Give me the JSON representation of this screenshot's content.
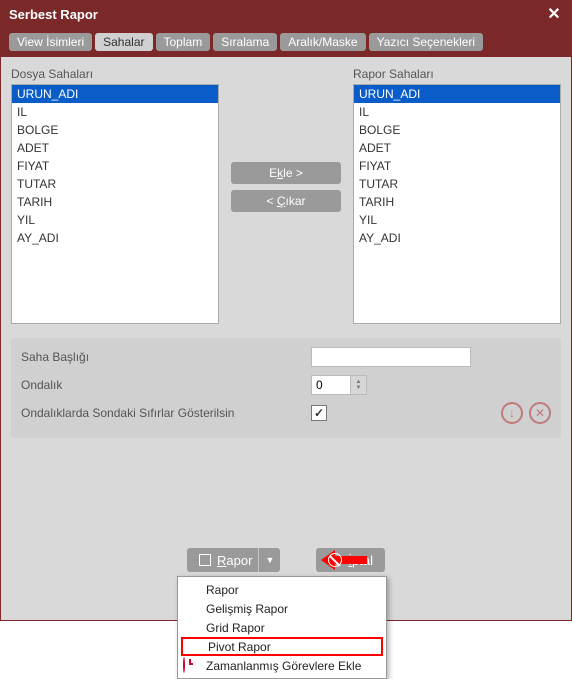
{
  "window": {
    "title": "Serbest Rapor"
  },
  "tabs": [
    {
      "label": "View İsimleri"
    },
    {
      "label": "Sahalar"
    },
    {
      "label": "Toplam"
    },
    {
      "label": "Sıralama"
    },
    {
      "label": "Aralık/Maske"
    },
    {
      "label": "Yazıcı Seçenekleri"
    }
  ],
  "active_tab": 1,
  "left_list": {
    "label": "Dosya Sahaları",
    "items": [
      "URUN_ADI",
      "IL",
      "BOLGE",
      "ADET",
      "FIYAT",
      "TUTAR",
      "TARIH",
      "YIL",
      "AY_ADI"
    ],
    "selected": 0
  },
  "right_list": {
    "label": "Rapor Sahaları",
    "items": [
      "URUN_ADI",
      "IL",
      "BOLGE",
      "ADET",
      "FIYAT",
      "TUTAR",
      "TARIH",
      "YIL",
      "AY_ADI"
    ],
    "selected": 0
  },
  "buttons": {
    "add_prefix": "E",
    "add_ul": "k",
    "add_suffix": "le >",
    "remove_prefix": "< ",
    "remove_ul": "Ç",
    "remove_suffix": "ıkar"
  },
  "panel": {
    "field_title_label": "Saha Başlığı",
    "field_title_value": "",
    "decimal_label": "Ondalık",
    "decimal_value": "0",
    "trailing_zeros_label": "Ondalıklarda Sondaki Sıfırlar Gösterilsin",
    "trailing_zeros_checked": true
  },
  "main_buttons": {
    "rapor_ul": "R",
    "rapor_rest": "apor",
    "iptal_ul": "İ",
    "iptal_rest": "ptal"
  },
  "menu": {
    "items": [
      "Rapor",
      "Gelişmiş Rapor",
      "Grid Rapor",
      "Pivot Rapor",
      "Zamanlanmış Görevlere Ekle"
    ],
    "highlighted": 3
  }
}
